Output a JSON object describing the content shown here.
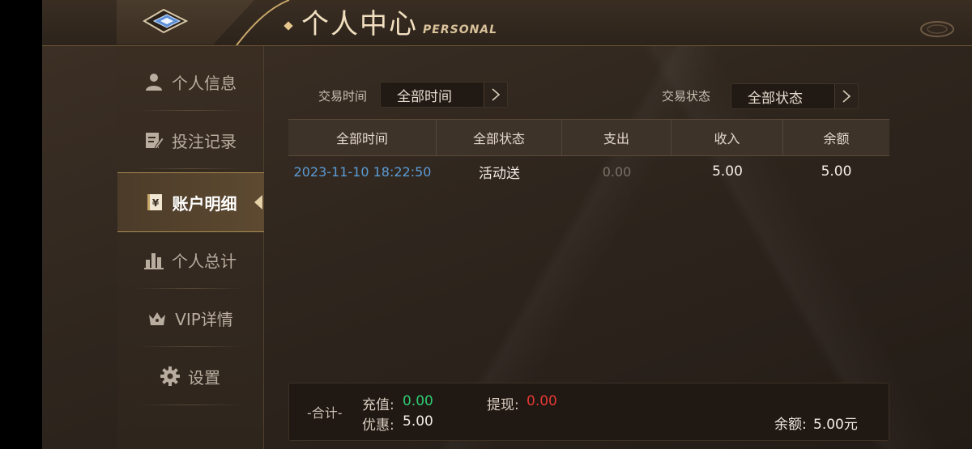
{
  "header": {
    "title_cn": "个人中心",
    "title_en": "PERSONAL"
  },
  "sidebar": {
    "items": [
      {
        "label": "个人信息",
        "icon": "person-icon",
        "active": false
      },
      {
        "label": "投注记录",
        "icon": "edit-record-icon",
        "active": false
      },
      {
        "label": "账户明细",
        "icon": "yen-ledger-icon",
        "active": true
      },
      {
        "label": "个人总计",
        "icon": "bar-chart-icon",
        "active": false
      },
      {
        "label": "VIP详情",
        "icon": "crown-icon",
        "active": false
      },
      {
        "label": "设置",
        "icon": "gear-icon",
        "active": false
      }
    ]
  },
  "filters": {
    "time_label": "交易时间",
    "time_value": "全部时间",
    "status_label": "交易状态",
    "status_value": "全部状态"
  },
  "table": {
    "columns": [
      "全部时间",
      "全部状态",
      "支出",
      "收入",
      "余额"
    ],
    "rows": [
      {
        "time": "2023-11-10 18:22:50",
        "status": "活动送",
        "expense": "0.00",
        "income": "5.00",
        "balance": "5.00"
      }
    ]
  },
  "summary": {
    "label": "-合计-",
    "recharge_label": "充值:",
    "recharge_value": "0.00",
    "withdraw_label": "提现:",
    "withdraw_value": "0.00",
    "bonus_label": "优惠:",
    "bonus_value": "5.00",
    "balance_label": "余额:",
    "balance_value": "5.00元"
  },
  "colors": {
    "accent_gold": "#e6c78c",
    "time_blue": "#5b9bd5",
    "recharge_green": "#2ecc71",
    "withdraw_red": "#e53935",
    "muted_gray": "#7a7068"
  }
}
